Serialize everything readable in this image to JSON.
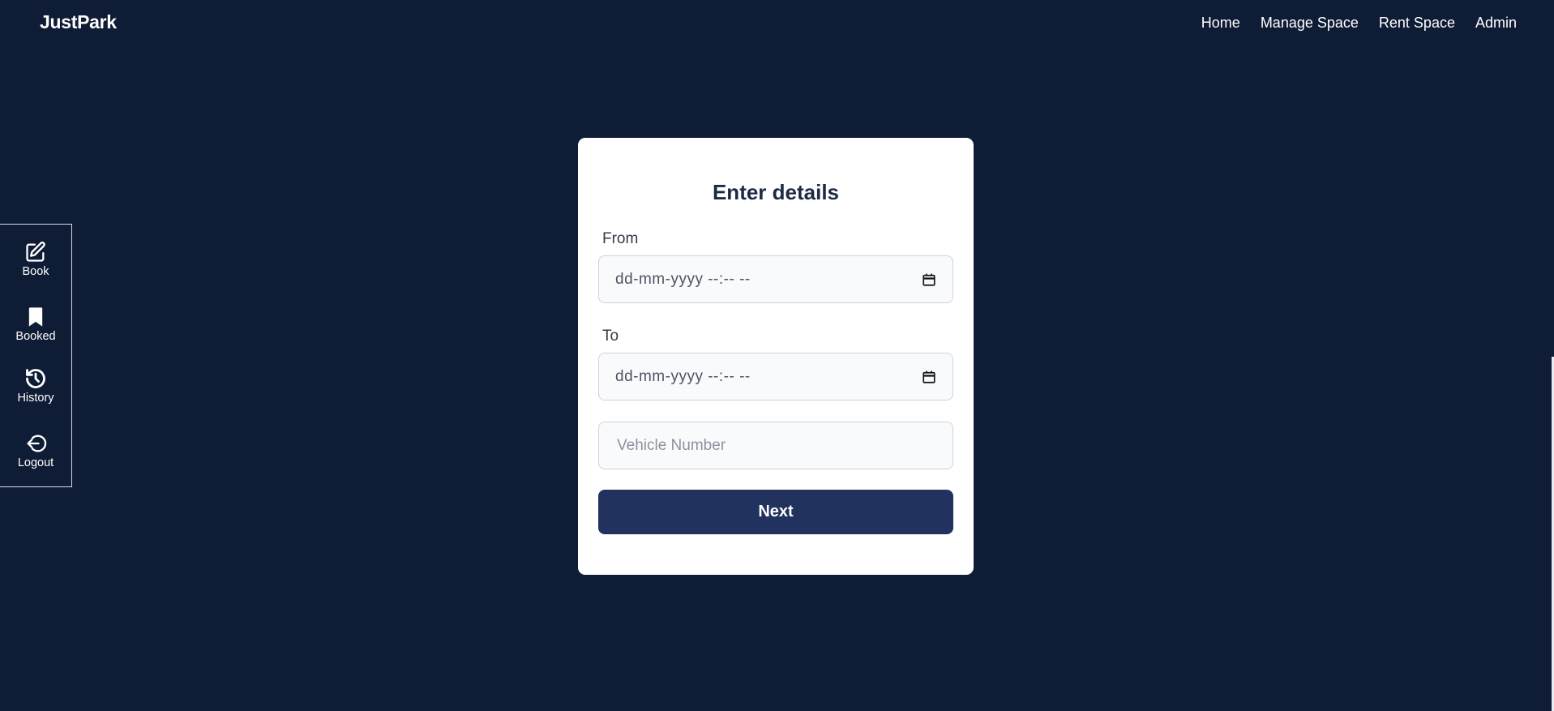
{
  "brand": "JustPark",
  "nav": [
    "Home",
    "Manage Space",
    "Rent Space",
    "Admin"
  ],
  "sidebar": {
    "items": [
      {
        "label": "Book",
        "icon": "edit-icon"
      },
      {
        "label": "Booked",
        "icon": "bookmark-icon"
      },
      {
        "label": "History",
        "icon": "history-icon"
      },
      {
        "label": "Logout",
        "icon": "logout-icon"
      }
    ]
  },
  "form": {
    "title": "Enter details",
    "from_label": "From",
    "from_value": "dd-mm-yyyy --:-- --",
    "to_label": "To",
    "to_value": "dd-mm-yyyy --:-- --",
    "vehicle_placeholder": "Vehicle Number",
    "next_label": "Next"
  },
  "colors": {
    "background": "#0f1c35",
    "button": "#20325d",
    "card": "#ffffff"
  }
}
